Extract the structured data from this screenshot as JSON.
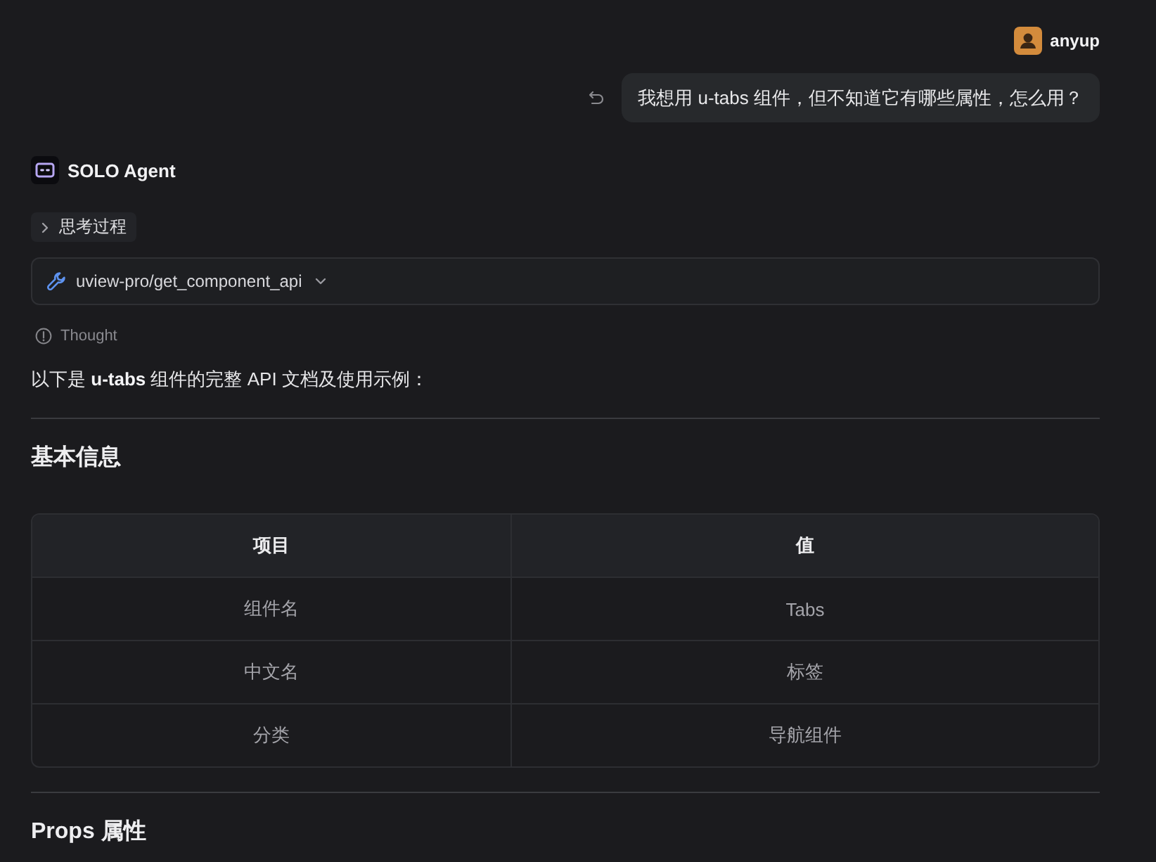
{
  "user": {
    "name": "anyup"
  },
  "message": {
    "text": "我想用 u-tabs 组件，但不知道它有哪些属性，怎么用？"
  },
  "agent": {
    "name": "SOLO Agent"
  },
  "thinking": {
    "label": "思考过程",
    "expanded": false
  },
  "tool_call": {
    "name": "uview-pro/get_component_api",
    "expanded": false
  },
  "thought": {
    "label": "Thought"
  },
  "intro": "以下是 **u-tabs** 组件的完整 API 文档及使用示例：",
  "sections": [
    {
      "heading": "基本信息",
      "table": {
        "columns": [
          "项目",
          "值"
        ],
        "rows": [
          [
            "组件名",
            "Tabs"
          ],
          [
            "中文名",
            "标签"
          ],
          [
            "分类",
            "导航组件"
          ]
        ]
      }
    },
    {
      "heading": "Props 属性"
    }
  ]
}
